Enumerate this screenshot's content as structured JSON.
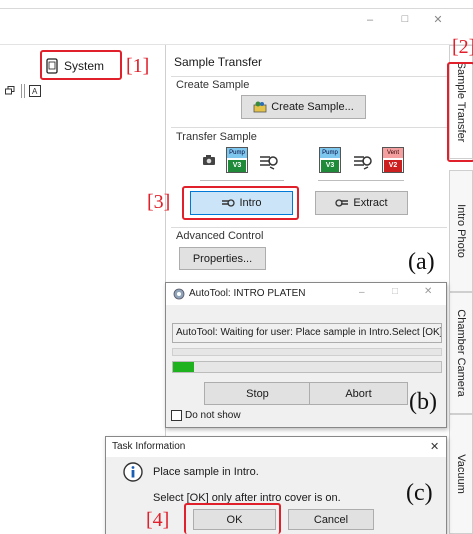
{
  "window": {
    "minimize_glyph": "–",
    "maximize_glyph": "□",
    "close_glyph": "✕"
  },
  "left_panel": {
    "system_label": "System"
  },
  "sample_transfer": {
    "title": "Sample Transfer",
    "create_group_title": "Create Sample",
    "create_button": "Create Sample...",
    "transfer_group_title": "Transfer Sample",
    "pump_label": "Pump",
    "vent_label": "Vent",
    "v3_label": "V3",
    "v2_label": "V2",
    "intro_button": "Intro",
    "extract_button": "Extract",
    "advanced_group_title": "Advanced Control",
    "properties_button": "Properties..."
  },
  "vertical_tabs": [
    "Sample Transfer",
    "Intro Photo",
    "Chamber Camera",
    "Vacuum"
  ],
  "autotool_dialog": {
    "title": "AutoTool: INTRO PLATEN",
    "message": "AutoTool: Waiting for user: Place sample in Intro.Select [OK]",
    "progress_fraction": 0.08,
    "stop_button": "Stop",
    "abort_button": "Abort",
    "do_not_show_label": "Do not show"
  },
  "task_dialog": {
    "title": "Task Information",
    "line1": "Place sample in Intro.",
    "line2": "Select [OK] only after intro cover is on.",
    "ok_button": "OK",
    "cancel_button": "Cancel",
    "close_glyph": "✕"
  },
  "annotations": {
    "label_1": "[1]",
    "label_2": "[2]",
    "label_3": "[3]",
    "label_4": "[4]",
    "panel_a": "(a)",
    "panel_b": "(b)",
    "panel_c": "(c)"
  },
  "colors": {
    "highlight_red": "#e0202a",
    "progress_green": "#1fb21f",
    "intro_button_blue": "#cce4f7",
    "pump_green": "#1e8a3a",
    "vent_red": "#cc1f1f"
  }
}
